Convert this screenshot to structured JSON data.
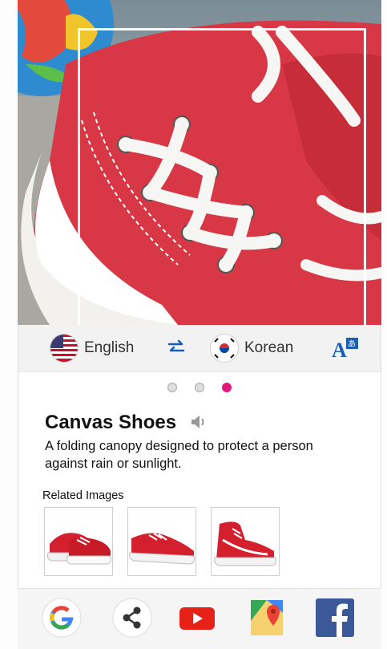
{
  "language_bar": {
    "source_language": "English",
    "target_language": "Korean",
    "swap_icon": "swap-arrows-icon",
    "translate_icon": "translate-a-icon"
  },
  "pager": {
    "count": 3,
    "active_index": 2,
    "active_color": "#e0187c"
  },
  "entry": {
    "word": "Canvas Shoes",
    "definition": "A folding canopy designed to protect a person against rain or sunlight."
  },
  "related": {
    "title": "Related Images",
    "images": [
      "red-sneakers-pair",
      "red-sneaker-side",
      "red-high-top"
    ]
  },
  "share_bar": {
    "items": [
      "google-icon",
      "share-icon",
      "youtube-icon",
      "maps-icon",
      "facebook-icon"
    ]
  },
  "colors": {
    "accent": "#1a5fb4",
    "pager_active": "#e0187c"
  }
}
